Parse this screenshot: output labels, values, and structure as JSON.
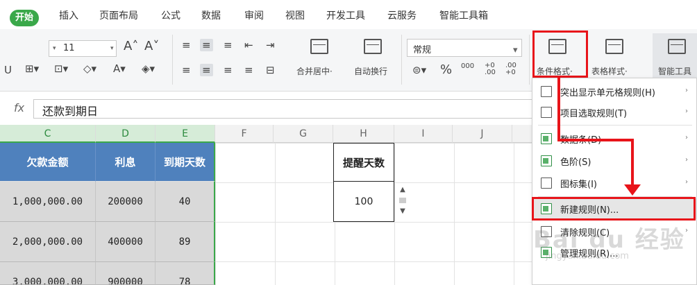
{
  "menubar": {
    "tabs": [
      "开始",
      "插入",
      "页面布局",
      "公式",
      "数据",
      "审阅",
      "视图",
      "开发工具",
      "云服务",
      "智能工具箱"
    ]
  },
  "ribbon": {
    "font_size": "11",
    "number_format": "常规",
    "merge_center": "合并居中·",
    "wrap_text": "自动换行",
    "conditional_format": "条件格式·",
    "table_style": "表格样式·",
    "smart_tool": "智能工具",
    "percent": "%",
    "thousands": "000",
    "inc_decimal": "+0 .00",
    "dec_decimal": ".00 +0"
  },
  "formula_bar": {
    "fx": "fx",
    "value": "还款到期日"
  },
  "grid": {
    "columns": [
      "C",
      "D",
      "E",
      "F",
      "G",
      "H",
      "I",
      "J"
    ],
    "headers": [
      "欠款金额",
      "利息",
      "到期天数"
    ],
    "rows": [
      [
        "1,000,000.00",
        "200000",
        "40"
      ],
      [
        "2,000,000.00",
        "400000",
        "89"
      ],
      [
        "3,000,000.00",
        "900000",
        "78"
      ]
    ],
    "remind_label": "提醒天数",
    "remind_value": "100"
  },
  "dropdown": {
    "items": [
      {
        "label": "突出显示单元格规则(H)",
        "arrow": "›"
      },
      {
        "label": "项目选取规则(T)",
        "arrow": "›"
      },
      {
        "label": "数据条(D)",
        "arrow": "›"
      },
      {
        "label": "色阶(S)",
        "arrow": "›"
      },
      {
        "label": "图标集(I)",
        "arrow": "›"
      },
      {
        "label": "新建规则(N)...",
        "arrow": ""
      },
      {
        "label": "清除规则(C)",
        "arrow": "›"
      },
      {
        "label": "管理规则(R)...",
        "arrow": ""
      }
    ]
  },
  "watermark": {
    "brand": "Bai du 经验",
    "url": "jingyan.baidu.com"
  },
  "colors": {
    "accent_green": "#3aa84a",
    "header_blue": "#4f81bd",
    "highlight_red": "#e8141a"
  }
}
